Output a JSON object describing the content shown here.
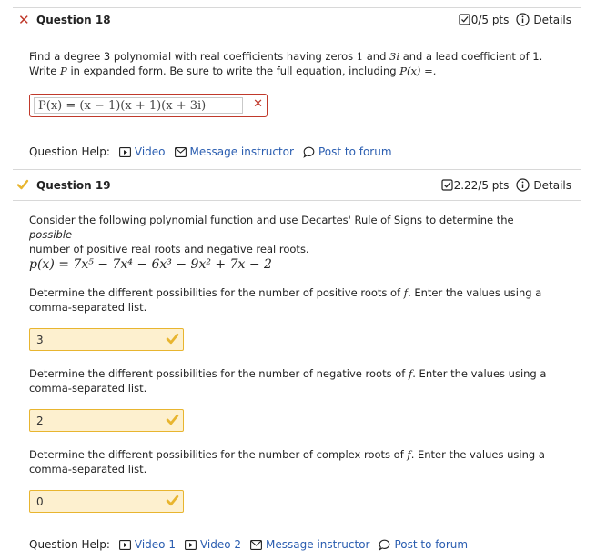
{
  "q18": {
    "title": "Question 18",
    "pts": "0/5 pts",
    "details": "Details",
    "prompt_a": "Find a degree 3 polynomial with real coefficients having zeros",
    "zero1": "1",
    "and": "and",
    "zero2": "3i",
    "prompt_b": "and a lead coefficient of 1.",
    "prompt_c": "Write",
    "var_p": "P",
    "prompt_d": "in expanded form. Be sure to write the full equation, including",
    "eq_lead": "P(x) =.",
    "answer": "P(x) = (x − 1)(x + 1)(x + 3i)",
    "help_label": "Question Help:",
    "help_links": [
      "Video",
      "Message instructor",
      "Post to forum"
    ]
  },
  "q19": {
    "title": "Question 19",
    "pts": "2.22/5 pts",
    "details": "Details",
    "intro_a": "Consider the following polynomial function and use Decartes' Rule of Signs to determine the",
    "intro_em": "possible",
    "intro_b": "number of positive real roots and negative real roots.",
    "function": "p(x) = 7x⁵ − 7x⁴ − 6x³ − 9x² + 7x − 2",
    "pos_q_a": "Determine the different possibilities for the number of positive roots of",
    "f": "f",
    "q_b": ". Enter the values using a",
    "q_c": "comma-separated list.",
    "pos_answer": "3",
    "neg_q_a": "Determine the different possibilities for the number of negative roots of",
    "neg_answer": "2",
    "cpx_q_a": "Determine the different possibilities for the number of complex roots of",
    "cpx_answer": "0",
    "help_label": "Question Help:",
    "help_links": [
      "Video 1",
      "Video 2",
      "Message instructor",
      "Post to forum"
    ]
  },
  "colors": {
    "wrong": "#c0392b",
    "correct": "#e8b52f",
    "link": "#2a5db0",
    "correct_bg": "#fdf0cf"
  }
}
